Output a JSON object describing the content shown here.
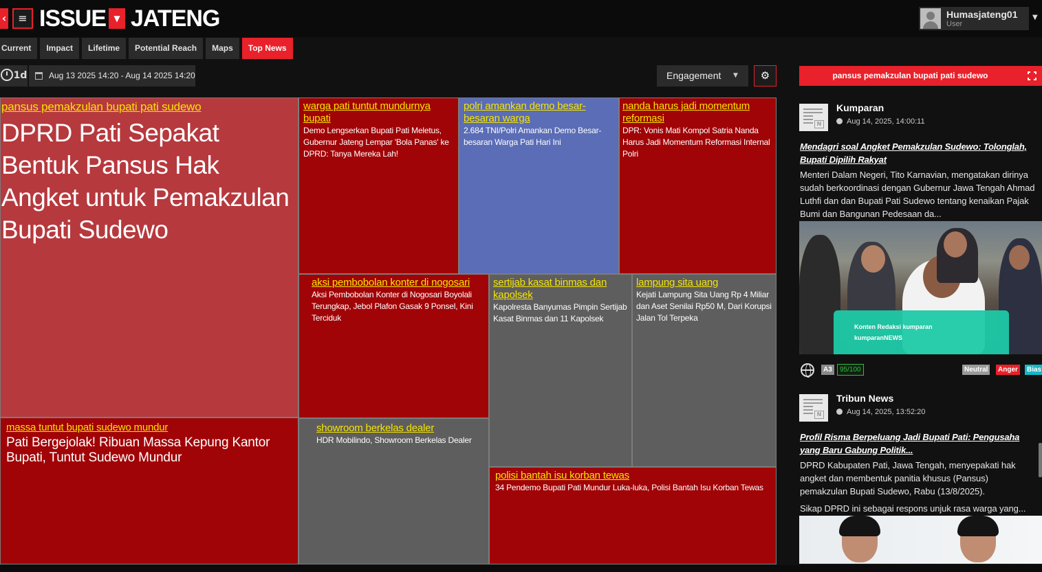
{
  "header": {
    "logo_left": "ISSUE",
    "logo_right": "JATENG",
    "user_name": "Humasjateng01",
    "user_role": "User"
  },
  "tabs": [
    "Current",
    "Impact",
    "Lifetime",
    "Potential Reach",
    "Maps",
    "Top News"
  ],
  "active_tab": "Top News",
  "toolbar": {
    "period": "1d",
    "date_range": "Aug 13 2025 14:20  - Aug 14 2025 14:20",
    "sort_select": "Engagement"
  },
  "treemap": [
    {
      "keyword": "pansus pemakzulan bupati pati sudewo",
      "headline": "DPRD Pati Sepakat Bentuk Pansus Hak Angket untuk Pemakzulan Bupati Sudewo",
      "color": "#b6393e"
    },
    {
      "keyword": "massa tuntut bupati sudewo mundur",
      "headline": "Pati Bergejolak! Ribuan Massa Kepung Kantor Bupati, Tuntut Sudewo Mundur",
      "color": "#a10407"
    },
    {
      "keyword": "warga pati tuntut mundurnya bupati",
      "headline": "Demo Lengserkan Bupati Pati Meletus, Gubernur Jateng Lempar 'Bola Panas' ke DPRD: Tanya Mereka Lah!",
      "color": "#a10407"
    },
    {
      "keyword": "polri amankan demo besar-besaran warga",
      "headline": "2.684 TNI/Polri Amankan Demo Besar-besaran Warga Pati Hari Ini",
      "color": "#5b6db6"
    },
    {
      "keyword": "nanda harus jadi momentum reformasi",
      "headline": "DPR: Vonis Mati Kompol Satria Nanda Harus Jadi Momentum Reformasi Internal Polri",
      "color": "#a10407"
    },
    {
      "keyword": "aksi pembobolan konter di nogosari",
      "headline": "Aksi Pembobolan Konter di Nogosari Boyolali Terungkap, Jebol Plafon Gasak 9 Ponsel, Kini Terciduk",
      "color": "#a10407"
    },
    {
      "keyword": "sertijab kasat binmas dan kapolsek",
      "headline": "Kapolresta Banyumas Pimpin Sertijab Kasat Binmas dan 11 Kapolsek",
      "color": "#5e5e5e"
    },
    {
      "keyword": "lampung sita uang",
      "headline": "Kejati Lampung Sita Uang Rp 4 Miliar dan Aset Senilai Rp50 M, Dari Korupsi Jalan Tol Terpeka",
      "color": "#5e5e5e"
    },
    {
      "keyword": "showroom berkelas dealer",
      "headline": "HDR Mobilindo, Showroom Berkelas Dealer",
      "color": "#5e5e5e"
    },
    {
      "keyword": "polisi bantah isu korban tewas",
      "headline": "34 Pendemo Bupati Pati Mundur Luka-luka, Polisi Bantah Isu Korban Tewas",
      "color": "#a10407"
    }
  ],
  "panel": {
    "title": "pansus pemakzulan bupati pati sudewo",
    "articles": [
      {
        "source": "Kumparan",
        "time": "Aug 14, 2025, 14:00:11",
        "title_line1": "Mendagri soal Angket Pemakzulan Sudewo: Tolonglah,",
        "title_line2": "Bupati Dipilih Rakyat",
        "body": [
          "Menteri Dalam Negeri, Tito Karnavian, mengatakan dirinya",
          "sudah berkoordinasi dengan Gubernur Jawa Tengah Ahmad",
          "Luthfi dan dan Bupati Pati Sudewo tentang kenaikan Pajak",
          "Bumi dan Bangunan Pedesaan da..."
        ],
        "image_caption_1": "Konten Redaksi kumparan",
        "image_caption_2": "kumparanNEWS",
        "badges": {
          "rank": "A3",
          "score": "95/100",
          "sentiment": "Neutral",
          "emotion": "Anger",
          "bias": "Bias"
        }
      },
      {
        "source": "Tribun News",
        "time": "Aug 14, 2025, 13:52:20",
        "title_line1": "Profil Risma Berpeluang Jadi Bupati Pati: Pengusaha",
        "title_line2": "yang Baru Gabung Politik...",
        "body": [
          "DPRD Kabupaten Pati, Jawa Tengah, menyepakati hak",
          "angket dan membentuk panitia khusus (Pansus)",
          "pemakzulan Bupati Sudewo, Rabu (13/8/2025).",
          "Sikap DPRD ini sebagai respons unjuk rasa warga yang..."
        ]
      }
    ]
  },
  "icons": [
    "back-arrow-icon",
    "hamburger-icon",
    "caret-down-icon",
    "user-avatar-icon",
    "clock-icon",
    "calendar-icon",
    "gear-icon",
    "expand-icon",
    "document-icon",
    "globe-icon"
  ]
}
